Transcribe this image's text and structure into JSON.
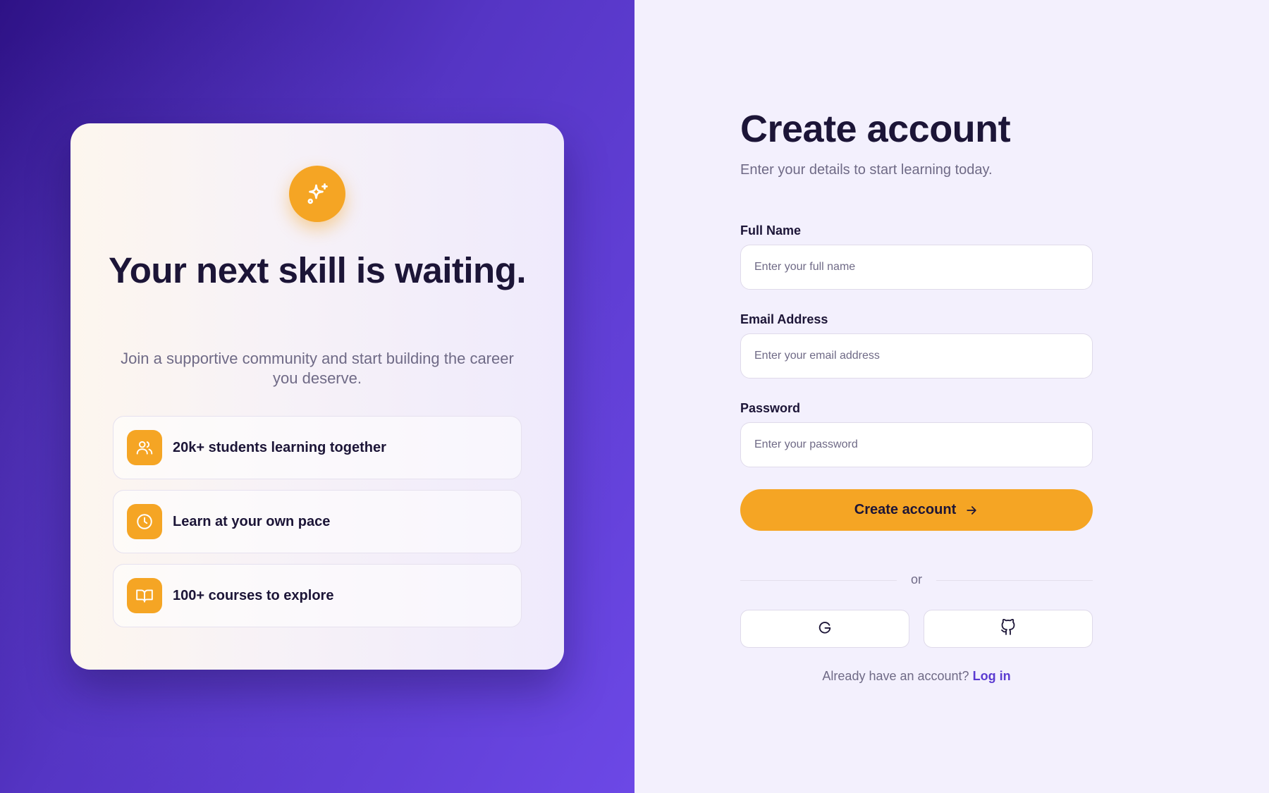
{
  "promo": {
    "title": "Your next skill is waiting.",
    "subtitle": "Join a supportive community and start building the career you deserve.",
    "badge_icon": "sparkles-icon",
    "features": [
      {
        "icon": "users-icon",
        "label": "20k+ students learning together"
      },
      {
        "icon": "clock-icon",
        "label": "Learn at your own pace"
      },
      {
        "icon": "book-open-icon",
        "label": "100+ courses to explore"
      }
    ]
  },
  "form": {
    "title": "Create account",
    "subtitle": "Enter your details to start learning today.",
    "fields": {
      "full_name": {
        "label": "Full Name",
        "placeholder": "Enter your full name",
        "value": ""
      },
      "email": {
        "label": "Email Address",
        "placeholder": "Enter your email address",
        "value": ""
      },
      "password": {
        "label": "Password",
        "placeholder": "Enter your password",
        "value": ""
      }
    },
    "submit_label": "Create account",
    "divider_text": "or",
    "social": [
      {
        "icon": "google-icon"
      },
      {
        "icon": "github-icon"
      }
    ],
    "login_prompt": "Already have an account?",
    "login_link": "Log in"
  },
  "colors": {
    "accent": "#f5a524",
    "brand": "#5b3bd1",
    "text_dark": "#1c1537",
    "text_muted": "#6f6a86",
    "right_bg": "#f3f0fd"
  }
}
